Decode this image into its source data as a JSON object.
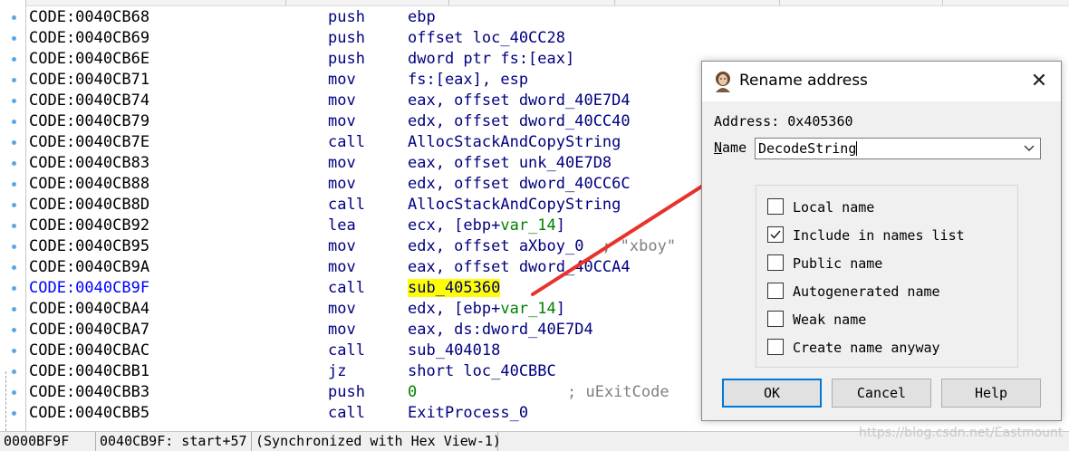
{
  "listing": [
    {
      "addr": "CODE:0040CB68",
      "mnem": "push",
      "ops": [
        {
          "t": "ebp"
        }
      ]
    },
    {
      "addr": "CODE:0040CB69",
      "mnem": "push",
      "ops": [
        {
          "t": "offset loc_40CC28"
        }
      ]
    },
    {
      "addr": "CODE:0040CB6E",
      "mnem": "push",
      "ops": [
        {
          "t": "dword ptr fs:[eax]"
        }
      ]
    },
    {
      "addr": "CODE:0040CB71",
      "mnem": "mov",
      "ops": [
        {
          "t": "fs:[eax], esp"
        }
      ]
    },
    {
      "addr": "CODE:0040CB74",
      "mnem": "mov",
      "ops": [
        {
          "t": "eax, offset dword_40E7D4"
        }
      ]
    },
    {
      "addr": "CODE:0040CB79",
      "mnem": "mov",
      "ops": [
        {
          "t": "edx, offset dword_40CC40"
        }
      ]
    },
    {
      "addr": "CODE:0040CB7E",
      "mnem": "call",
      "ops": [
        {
          "t": "AllocStackAndCopyString"
        }
      ]
    },
    {
      "addr": "CODE:0040CB83",
      "mnem": "mov",
      "ops": [
        {
          "t": "eax, offset unk_40E7D8"
        }
      ]
    },
    {
      "addr": "CODE:0040CB88",
      "mnem": "mov",
      "ops": [
        {
          "t": "edx, offset dword_40CC6C"
        }
      ]
    },
    {
      "addr": "CODE:0040CB8D",
      "mnem": "call",
      "ops": [
        {
          "t": "AllocStackAndCopyString"
        }
      ]
    },
    {
      "addr": "CODE:0040CB92",
      "mnem": "lea",
      "ops": [
        {
          "t": "ecx, [ebp+"
        },
        {
          "t": "var_14",
          "k": "var"
        },
        {
          "t": "]"
        }
      ]
    },
    {
      "addr": "CODE:0040CB95",
      "mnem": "mov",
      "ops": [
        {
          "t": "edx, offset aXboy_0"
        }
      ],
      "comment": "; \"xboy\""
    },
    {
      "addr": "CODE:0040CB9A",
      "mnem": "mov",
      "ops": [
        {
          "t": "eax, offset dword_40CCA4"
        }
      ]
    },
    {
      "addr": "CODE:0040CB9F",
      "mnem": "call",
      "ops": [
        {
          "t": "sub_405360",
          "k": "hl"
        }
      ],
      "current": true
    },
    {
      "addr": "CODE:0040CBA4",
      "mnem": "mov",
      "ops": [
        {
          "t": "edx, [ebp+"
        },
        {
          "t": "var_14",
          "k": "var"
        },
        {
          "t": "]"
        }
      ]
    },
    {
      "addr": "CODE:0040CBA7",
      "mnem": "mov",
      "ops": [
        {
          "t": "eax, ds:dword_40E7D4"
        }
      ]
    },
    {
      "addr": "CODE:0040CBAC",
      "mnem": "call",
      "ops": [
        {
          "t": "sub_404018"
        }
      ]
    },
    {
      "addr": "CODE:0040CBB1",
      "mnem": "jz",
      "ops": [
        {
          "t": "short loc_40CBBC"
        }
      ]
    },
    {
      "addr": "CODE:0040CBB3",
      "mnem": "push",
      "ops": [
        {
          "t": "0",
          "k": "num"
        }
      ],
      "comment": "; uExitCode"
    },
    {
      "addr": "CODE:0040CBB5",
      "mnem": "call",
      "ops": [
        {
          "t": "ExitProcess_0"
        }
      ]
    }
  ],
  "status": {
    "offset": "0000BF9F",
    "location": "0040CB9F: start+57",
    "sync": "(Synchronized with Hex View-1)"
  },
  "watermark": "https://blog.csdn.net/Eastmount",
  "dialog": {
    "title": "Rename address",
    "close_glyph": "✕",
    "address_line": "Address: 0x405360",
    "name_label_ul": "N",
    "name_label_rest": "ame",
    "name_value": "DecodeString",
    "options": [
      {
        "label": "Local name",
        "checked": false
      },
      {
        "label": "Include in names list",
        "checked": true
      },
      {
        "label": "Public name",
        "checked": false
      },
      {
        "label": "Autogenerated name",
        "checked": false
      },
      {
        "label": "Weak name",
        "checked": false
      },
      {
        "label": "Create name anyway",
        "checked": false
      }
    ],
    "buttons": {
      "ok": "OK",
      "cancel": "Cancel",
      "help": "Help"
    }
  },
  "colors": {
    "mnemonic": "#000080",
    "current_address": "#0000ff",
    "highlight": "#ffff00",
    "variable": "#008000",
    "comment": "#808080",
    "arrow": "#e8322c",
    "default_button_border": "#0078d7"
  }
}
